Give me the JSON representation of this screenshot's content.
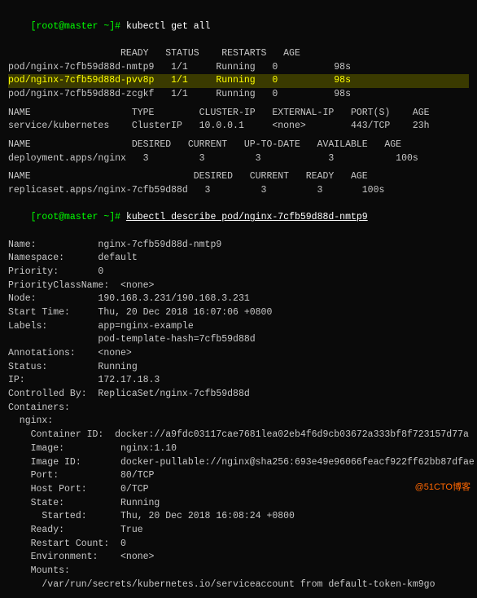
{
  "terminal": {
    "lines": [
      {
        "id": "cmd1",
        "type": "prompt",
        "text": "[root@master ~]# kubectl get all"
      },
      {
        "id": "header1",
        "type": "header",
        "text": "                    READY   STATUS    RESTARTS   AGE"
      },
      {
        "id": "pod1",
        "type": "normal",
        "text": "pod/nginx-7cfb59d88d-nmtp9   1/1     Running   0          98s"
      },
      {
        "id": "pod2",
        "type": "highlight",
        "text": "pod/nginx-7cfb59d88d-pvv8p   1/1     Running   0          98s"
      },
      {
        "id": "pod3",
        "type": "normal",
        "text": "pod/nginx-7cfb59d88d-zcgkf   1/1     Running   0          98s"
      },
      {
        "id": "gap1",
        "type": "gap"
      },
      {
        "id": "svc-header",
        "type": "header",
        "text": "NAME                  TYPE        CLUSTER-IP   EXTERNAL-IP   PORT(S)    AGE"
      },
      {
        "id": "svc1",
        "type": "normal",
        "text": "service/kubernetes    ClusterIP   10.0.0.1     <none>        443/TCP    23h"
      },
      {
        "id": "gap2",
        "type": "gap"
      },
      {
        "id": "deploy-header",
        "type": "header",
        "text": "NAME                  DESIRED   CURRENT   UP-TO-DATE   AVAILABLE   AGE"
      },
      {
        "id": "deploy1",
        "type": "normal",
        "text": "deployment.apps/nginx   3         3         3            3           100s"
      },
      {
        "id": "gap3",
        "type": "gap"
      },
      {
        "id": "rs-header",
        "type": "header",
        "text": "NAME                             DESIRED   CURRENT   READY   AGE"
      },
      {
        "id": "rs1",
        "type": "normal",
        "text": "replicaset.apps/nginx-7cfb59d88d   3         3         3       100s"
      },
      {
        "id": "cmd2",
        "type": "prompt-underline",
        "text": "[root@master ~]# kubectl describe pod/nginx-7cfb59d88d-nmtp9"
      },
      {
        "id": "name-line",
        "type": "normal",
        "text": "Name:           nginx-7cfb59d88d-nmtp9"
      },
      {
        "id": "ns-line",
        "type": "normal",
        "text": "Namespace:      default"
      },
      {
        "id": "pri-line",
        "type": "normal",
        "text": "Priority:       0"
      },
      {
        "id": "pricls-line",
        "type": "normal",
        "text": "PriorityClassName:  <none>"
      },
      {
        "id": "node-line",
        "type": "normal",
        "text": "Node:           190.168.3.231/190.168.3.231"
      },
      {
        "id": "start-line",
        "type": "normal",
        "text": "Start Time:     Thu, 20 Dec 2018 16:07:06 +0800"
      },
      {
        "id": "labels-line",
        "type": "normal",
        "text": "Labels:         app=nginx-example"
      },
      {
        "id": "labels2-line",
        "type": "normal",
        "text": "                pod-template-hash=7cfb59d88d"
      },
      {
        "id": "annot-line",
        "type": "normal",
        "text": "Annotations:    <none>"
      },
      {
        "id": "status-line",
        "type": "normal",
        "text": "Status:         Running"
      },
      {
        "id": "ip-line",
        "type": "normal",
        "text": "IP:             172.17.18.3"
      },
      {
        "id": "ctrl-line",
        "type": "normal",
        "text": "Controlled By:  ReplicaSet/nginx-7cfb59d88d"
      },
      {
        "id": "cont-header",
        "type": "normal",
        "text": "Containers:"
      },
      {
        "id": "nginx-label",
        "type": "normal",
        "text": "  nginx:"
      },
      {
        "id": "contid-line",
        "type": "normal",
        "text": "    Container ID:  docker://a9fdc03117cae7681lea02eb4f6d9cb03672a333bf8f723157d77a"
      },
      {
        "id": "image-line",
        "type": "normal",
        "text": "    Image:          nginx:1.10"
      },
      {
        "id": "imageid-line",
        "type": "normal",
        "text": "    Image ID:       docker-pullable://nginx@sha256:693e49e96066feacf922ff62bb87dfae"
      },
      {
        "id": "port-line",
        "type": "normal",
        "text": "    Port:           80/TCP"
      },
      {
        "id": "hport-line",
        "type": "normal",
        "text": "    Host Port:      0/TCP"
      },
      {
        "id": "state-line",
        "type": "normal",
        "text": "    State:          Running"
      },
      {
        "id": "started-line",
        "type": "normal",
        "text": "      Started:      Thu, 20 Dec 2018 16:08:24 +0800"
      },
      {
        "id": "ready-line",
        "type": "normal",
        "text": "    Ready:          True"
      },
      {
        "id": "restart-line",
        "type": "normal",
        "text": "    Restart Count:  0"
      },
      {
        "id": "env-line",
        "type": "normal",
        "text": "    Environment:    <none>"
      },
      {
        "id": "mounts-line",
        "type": "normal",
        "text": "    Mounts:"
      },
      {
        "id": "mounts2-line",
        "type": "normal",
        "text": "      /var/run/secrets/kubernetes.io/serviceaccount from default-token-km9go"
      }
    ]
  },
  "watermark": "@51CTO博客"
}
